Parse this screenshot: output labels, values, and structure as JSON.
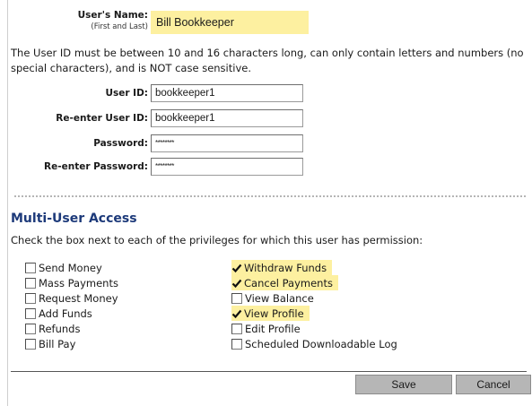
{
  "user_name": {
    "label": "User's Name:",
    "hint": "(First and Last)",
    "value": "Bill Bookkeeper"
  },
  "userid_rules": "The User ID must be between 10 and 16 characters long, can only contain letters and numbers (no special characters), and is NOT case sensitive.",
  "fields": {
    "user_id": {
      "label": "User ID:",
      "value": "bookkeeper1"
    },
    "reenter_user_id": {
      "label": "Re-enter User ID:",
      "value": "bookkeeper1"
    },
    "password": {
      "label": "Password:",
      "value": "********"
    },
    "reenter_password": {
      "label": "Re-enter Password:",
      "value": "********"
    }
  },
  "multi_user": {
    "title": "Multi-User Access",
    "instructions": "Check the box next to each of the privileges for which this user has permission:",
    "left_column": [
      {
        "label": "Send Money",
        "checked": false
      },
      {
        "label": "Mass Payments",
        "checked": false
      },
      {
        "label": "Request Money",
        "checked": false
      },
      {
        "label": "Add Funds",
        "checked": false
      },
      {
        "label": "Refunds",
        "checked": false
      },
      {
        "label": "Bill Pay",
        "checked": false
      }
    ],
    "right_column": [
      {
        "label": "Withdraw Funds",
        "checked": true
      },
      {
        "label": "Cancel Payments",
        "checked": true
      },
      {
        "label": "View Balance",
        "checked": false
      },
      {
        "label": "View Profile",
        "checked": true
      },
      {
        "label": "Edit Profile",
        "checked": false
      },
      {
        "label": "Scheduled Downloadable Log",
        "checked": false
      }
    ]
  },
  "buttons": {
    "save": "Save",
    "cancel": "Cancel"
  },
  "colors": {
    "highlight": "#fdf0a0",
    "section_title": "#1d3a7a",
    "button": "#b6b6b6"
  }
}
